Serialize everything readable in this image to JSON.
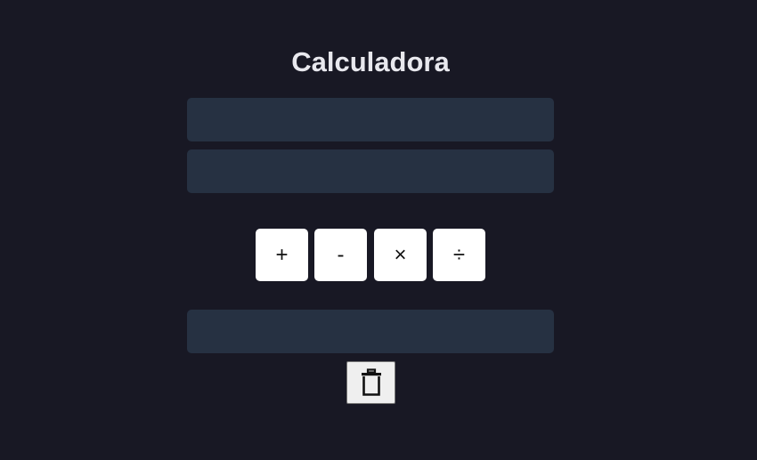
{
  "app": {
    "title": "Calculadora"
  },
  "inputs": {
    "first_value": "",
    "first_placeholder": "",
    "second_value": "",
    "second_placeholder": "",
    "result_value": "",
    "result_placeholder": ""
  },
  "operations": {
    "add_label": "+",
    "subtract_label": "-",
    "multiply_label": "×",
    "divide_label": "÷"
  },
  "clear_button": {
    "icon": "trash-icon"
  },
  "colors": {
    "background": "#181824",
    "field": "#263142",
    "button": "#ffffff",
    "text": "#e8e8ee"
  }
}
